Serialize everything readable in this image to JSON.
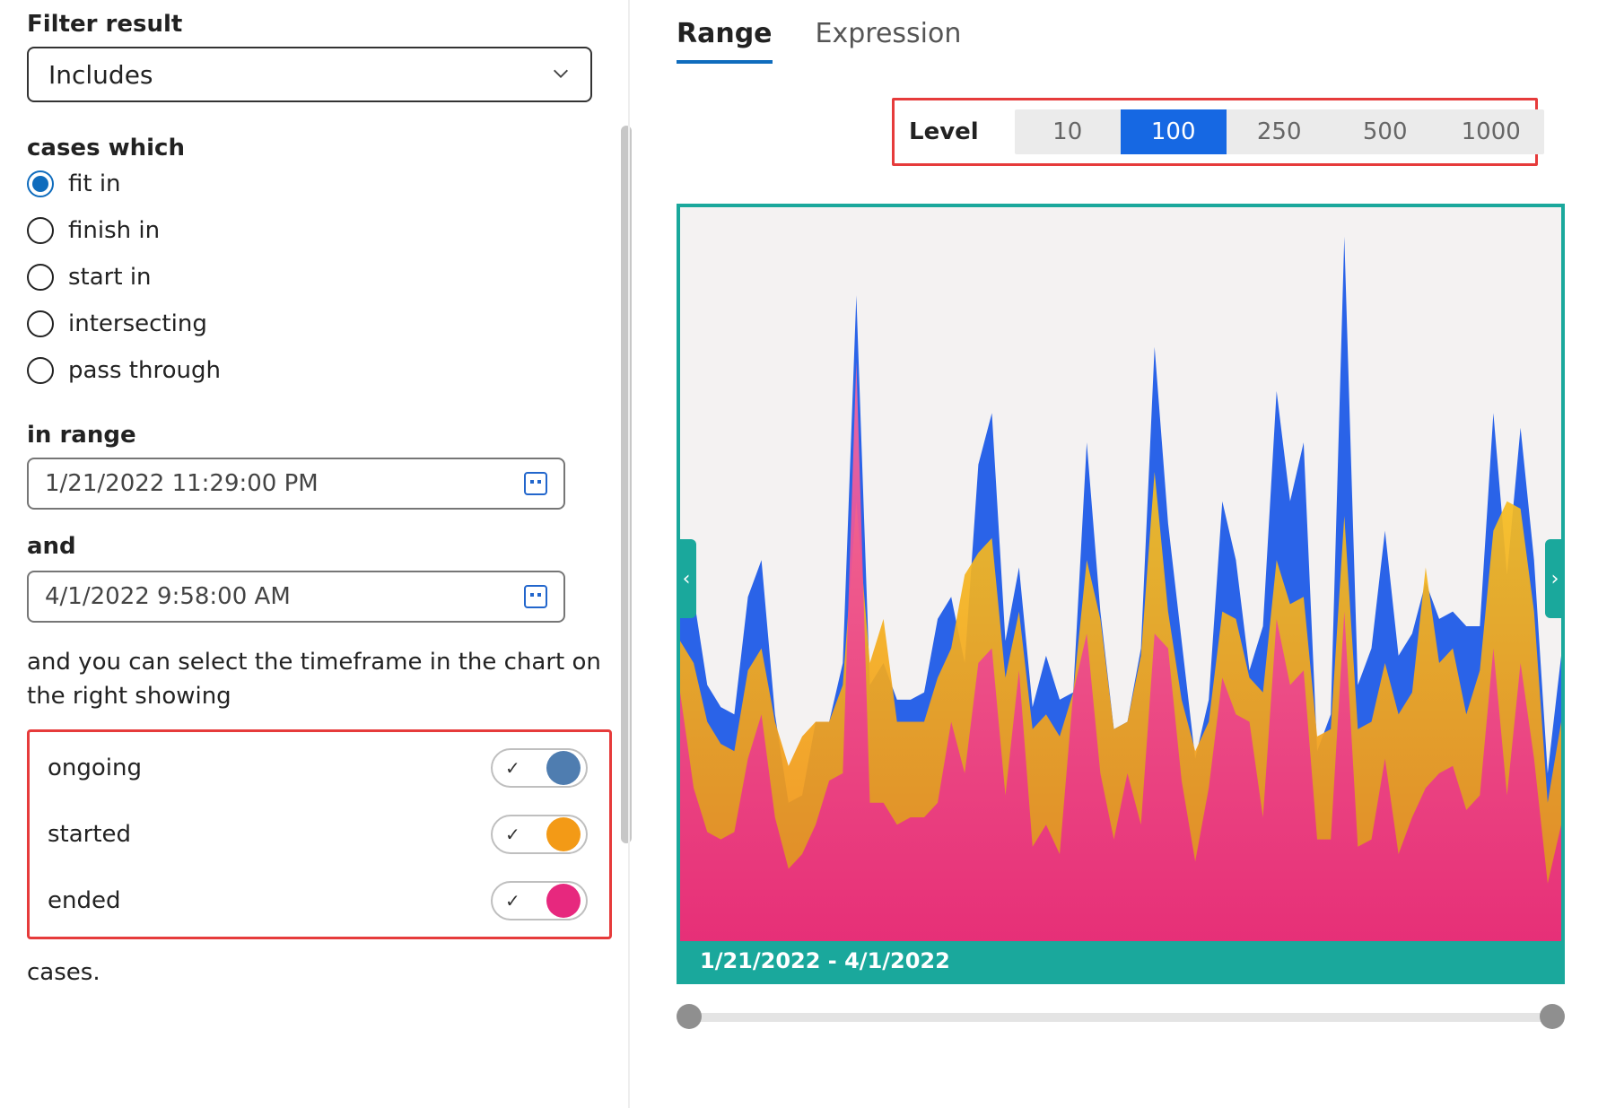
{
  "filter": {
    "label": "Filter result",
    "select_value": "Includes"
  },
  "cases_which": {
    "label": "cases which",
    "options": [
      "fit in",
      "finish in",
      "start in",
      "intersecting",
      "pass through"
    ],
    "selected": "fit in"
  },
  "range": {
    "in_range_label": "in range",
    "start": "1/21/2022 11:29:00 PM",
    "and_label": "and",
    "end": "4/1/2022 9:58:00 AM"
  },
  "help_text": "and you can select the timeframe in the chart on the right showing",
  "legend": [
    {
      "key": "ongoing",
      "label": "ongoing",
      "checked": true,
      "color": "#4f7db0"
    },
    {
      "key": "started",
      "label": "started",
      "checked": true,
      "color": "#f39a16"
    },
    {
      "key": "ended",
      "label": "ended",
      "checked": true,
      "color": "#e7287e"
    }
  ],
  "cases_tail": "cases.",
  "tabs": {
    "items": [
      "Range",
      "Expression"
    ],
    "active": "Range"
  },
  "level": {
    "label": "Level",
    "options": [
      "10",
      "100",
      "250",
      "500",
      "1000"
    ],
    "selected": "100"
  },
  "chart_footer": "1/21/2022 - 4/1/2022",
  "chart_data": {
    "type": "area",
    "xlabel": "",
    "ylabel": "",
    "x_range": [
      "1/21/2022",
      "4/1/2022"
    ],
    "ylim": [
      0,
      100
    ],
    "series": [
      {
        "name": "ongoing",
        "color": "#2a63e8",
        "values": [
          51,
          47,
          35,
          32,
          31,
          47,
          52,
          31,
          19,
          20,
          30,
          30,
          38,
          88,
          35,
          38,
          33,
          33,
          34,
          44,
          47,
          38,
          65,
          72,
          41,
          51,
          32,
          39,
          33,
          34,
          68,
          45,
          29,
          30,
          40,
          81,
          57,
          41,
          25,
          33,
          60,
          52,
          37,
          43,
          75,
          60,
          68,
          26,
          31,
          96,
          35,
          40,
          56,
          39,
          42,
          49,
          44,
          45,
          43,
          43,
          72,
          50,
          70,
          52,
          23,
          39
        ]
      },
      {
        "name": "started",
        "color_top": "#f6c021",
        "color_bottom": "#f08a17",
        "values": [
          41,
          38,
          30,
          27,
          26,
          37,
          40,
          30,
          24,
          28,
          30,
          30,
          35,
          60,
          38,
          44,
          30,
          30,
          30,
          36,
          40,
          50,
          53,
          55,
          36,
          45,
          29,
          31,
          28,
          34,
          52,
          44,
          29,
          30,
          39,
          64,
          45,
          33,
          26,
          30,
          45,
          44,
          36,
          34,
          52,
          46,
          47,
          28,
          29,
          58,
          29,
          30,
          38,
          31,
          34,
          51,
          38,
          40,
          31,
          37,
          56,
          60,
          59,
          45,
          19,
          30
        ]
      },
      {
        "name": "ended",
        "color_top": "#f46aa1",
        "color_bottom": "#e7287e",
        "values": [
          34,
          21,
          15,
          14,
          15,
          25,
          31,
          17,
          10,
          12,
          16,
          22,
          23,
          79,
          19,
          19,
          16,
          17,
          17,
          19,
          30,
          23,
          38,
          40,
          20,
          37,
          13,
          16,
          12,
          34,
          42,
          23,
          14,
          23,
          16,
          42,
          40,
          22,
          11,
          21,
          36,
          31,
          30,
          17,
          44,
          35,
          37,
          14,
          14,
          45,
          13,
          14,
          25,
          12,
          17,
          21,
          23,
          24,
          18,
          20,
          40,
          20,
          38,
          25,
          8,
          16
        ]
      }
    ]
  }
}
